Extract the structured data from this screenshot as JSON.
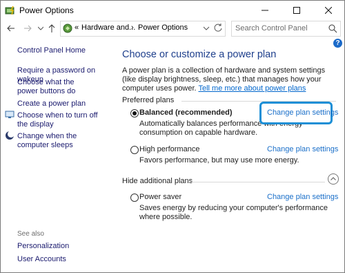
{
  "window": {
    "title": "Power Options"
  },
  "nav": {
    "breadcrumb_prefix": "«",
    "crumb_1": "Hardware and...",
    "crumb_sep": "›",
    "crumb_2": "Power Options",
    "search_placeholder": "Search Control Panel"
  },
  "sidebar": {
    "home": "Control Panel Home",
    "items": [
      {
        "label": "Require a password on wakeup"
      },
      {
        "label": "Choose what the power buttons do"
      },
      {
        "label": "Create a power plan"
      },
      {
        "label": "Choose when to turn off the display"
      },
      {
        "label": "Change when the computer sleeps"
      }
    ],
    "see_also": "See also",
    "see_also_items": [
      {
        "label": "Personalization"
      },
      {
        "label": "User Accounts"
      }
    ]
  },
  "help": "?",
  "main": {
    "title": "Choose or customize a power plan",
    "intro": "A power plan is a collection of hardware and system settings (like display brightness, sleep, etc.) that manages how your computer uses power.",
    "intro_link": "Tell me more about power plans",
    "preferred_label": "Preferred plans",
    "hide_label": "Hide additional plans",
    "change_label": "Change plan settings",
    "plans": [
      {
        "name": "Balanced (recommended)",
        "desc": "Automatically balances performance with energy consumption on capable hardware.",
        "selected": true
      },
      {
        "name": "High performance",
        "desc": "Favors performance, but may use more energy.",
        "selected": false
      },
      {
        "name": "Power saver",
        "desc": "Saves energy by reducing your computer's performance where possible.",
        "selected": false
      }
    ]
  },
  "colors": {
    "accent": "#1b8fd6",
    "title": "#1e3f8c",
    "link": "#1a6fc9",
    "sidebar_link": "#1a1a6e"
  }
}
